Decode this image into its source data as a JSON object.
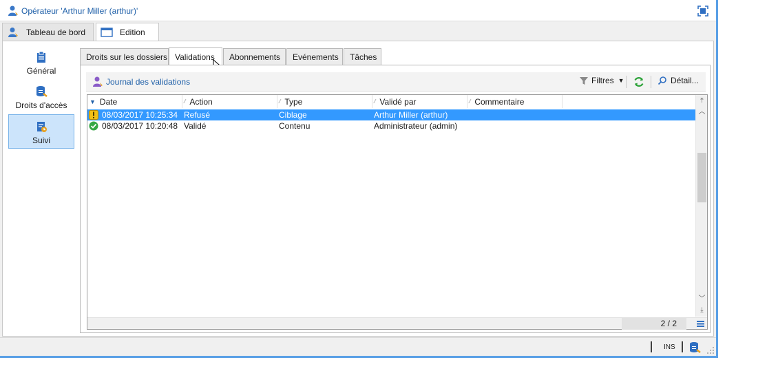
{
  "window": {
    "title": "Opérateur 'Arthur Miller (arthur)'"
  },
  "top_tabs": [
    {
      "label": "Tableau de bord",
      "icon": "operator-icon"
    },
    {
      "label": "Edition",
      "icon": "form-icon"
    }
  ],
  "left_nav": [
    {
      "label": "Général",
      "icon": "clipboard-icon"
    },
    {
      "label": "Droits d'accès",
      "icon": "database-key-icon"
    },
    {
      "label": "Suivi",
      "icon": "tracking-icon"
    }
  ],
  "sub_tabs": [
    {
      "label": "Droits sur les dossiers"
    },
    {
      "label": "Validations"
    },
    {
      "label": "Abonnements"
    },
    {
      "label": "Evénements"
    },
    {
      "label": "Tâches"
    }
  ],
  "toolbar": {
    "journal_label": "Journal des validations",
    "filters_label": "Filtres",
    "detail_label": "Détail..."
  },
  "grid": {
    "columns": [
      "Date",
      "Action",
      "Type",
      "Validé par",
      "Commentaire"
    ],
    "rows": [
      {
        "status_icon": "warning-icon",
        "date": "08/03/2017 10:25:34",
        "action": "Refusé",
        "type": "Ciblage",
        "validated_by": "Arthur Miller (arthur)",
        "comment": "",
        "selected": true
      },
      {
        "status_icon": "check-icon",
        "date": "08/03/2017 10:20:48",
        "action": "Validé",
        "type": "Contenu",
        "validated_by": "Administrateur (admin)",
        "comment": "",
        "selected": false
      }
    ],
    "count": "2 / 2"
  },
  "statusbar": {
    "mode": "INS"
  },
  "colors": {
    "accent": "#1e5fa8",
    "selection": "#3399ff",
    "nav_active": "#cce4fb",
    "frame": "#5aa0e6"
  }
}
